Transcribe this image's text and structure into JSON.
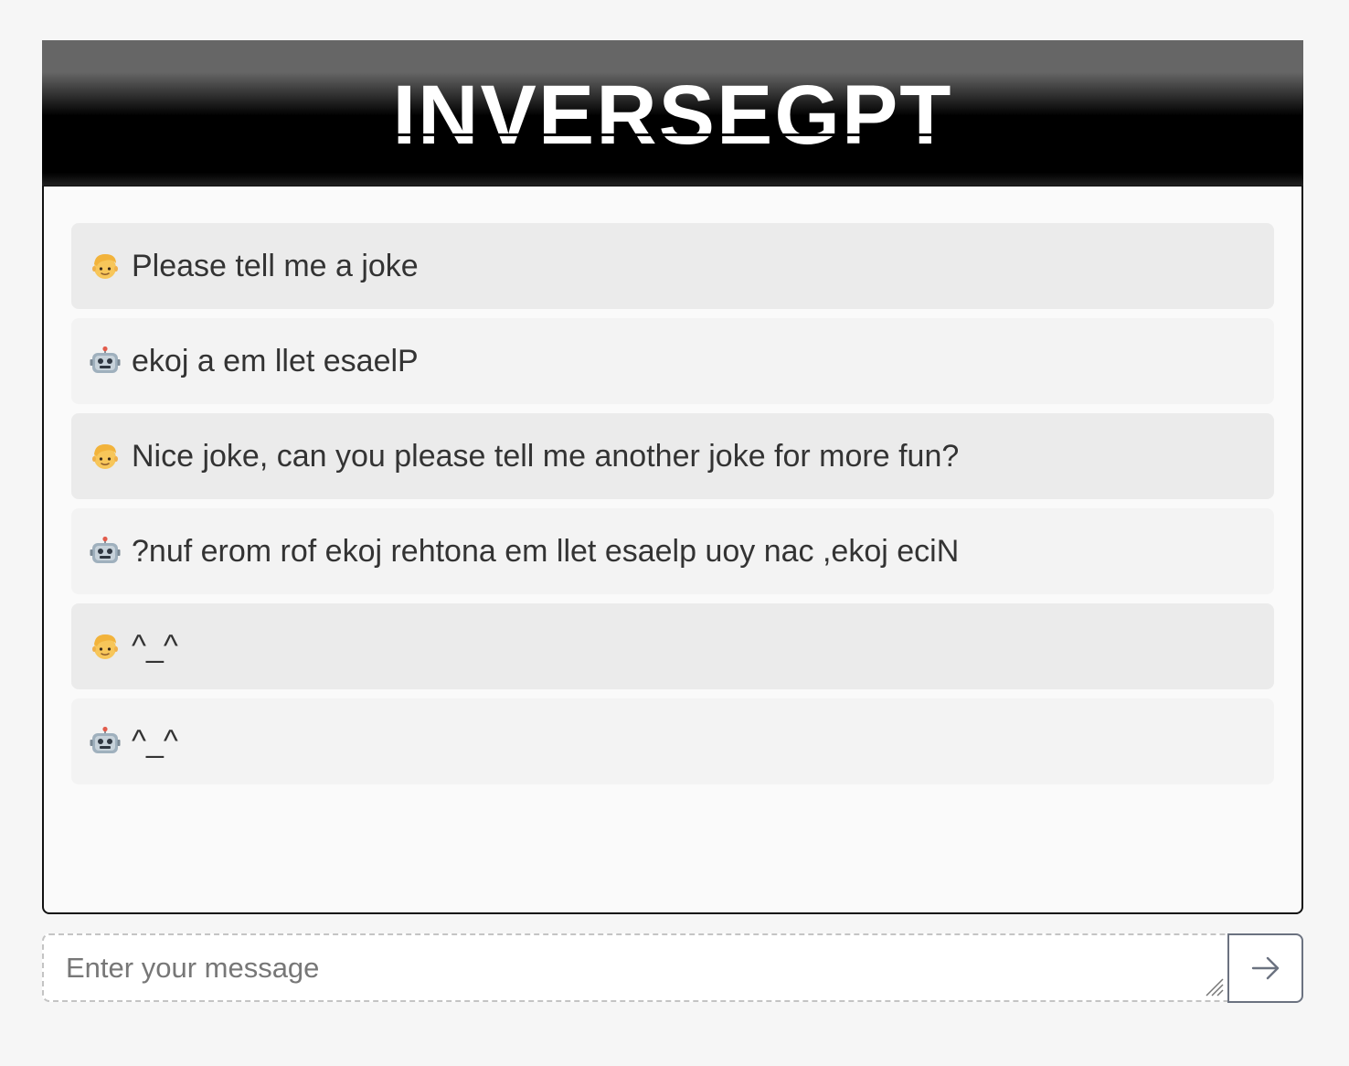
{
  "app": {
    "title": "INVERSEGPT"
  },
  "messages": [
    {
      "role": "user",
      "avatar_icon": "person-icon",
      "text": "Please tell me a joke"
    },
    {
      "role": "bot",
      "avatar_icon": "robot-icon",
      "text": "ekoj a em llet esaelP"
    },
    {
      "role": "user",
      "avatar_icon": "person-icon",
      "text": "Nice joke, can you please tell me another joke for more fun?"
    },
    {
      "role": "bot",
      "avatar_icon": "robot-icon",
      "text": "?nuf erom rof ekoj rehtona em llet esaelp uoy nac ,ekoj eciN"
    },
    {
      "role": "user",
      "avatar_icon": "person-icon",
      "text": "^_^"
    },
    {
      "role": "bot",
      "avatar_icon": "robot-icon",
      "text": "^_^"
    }
  ],
  "composer": {
    "placeholder": "Enter your message",
    "value": "",
    "send_icon": "arrow-right-icon"
  },
  "colors": {
    "page_bg": "#f6f6f6",
    "header_bg": "#000000",
    "user_bubble": "#ebebeb",
    "bot_bubble": "#f3f3f3",
    "text": "#333333"
  }
}
